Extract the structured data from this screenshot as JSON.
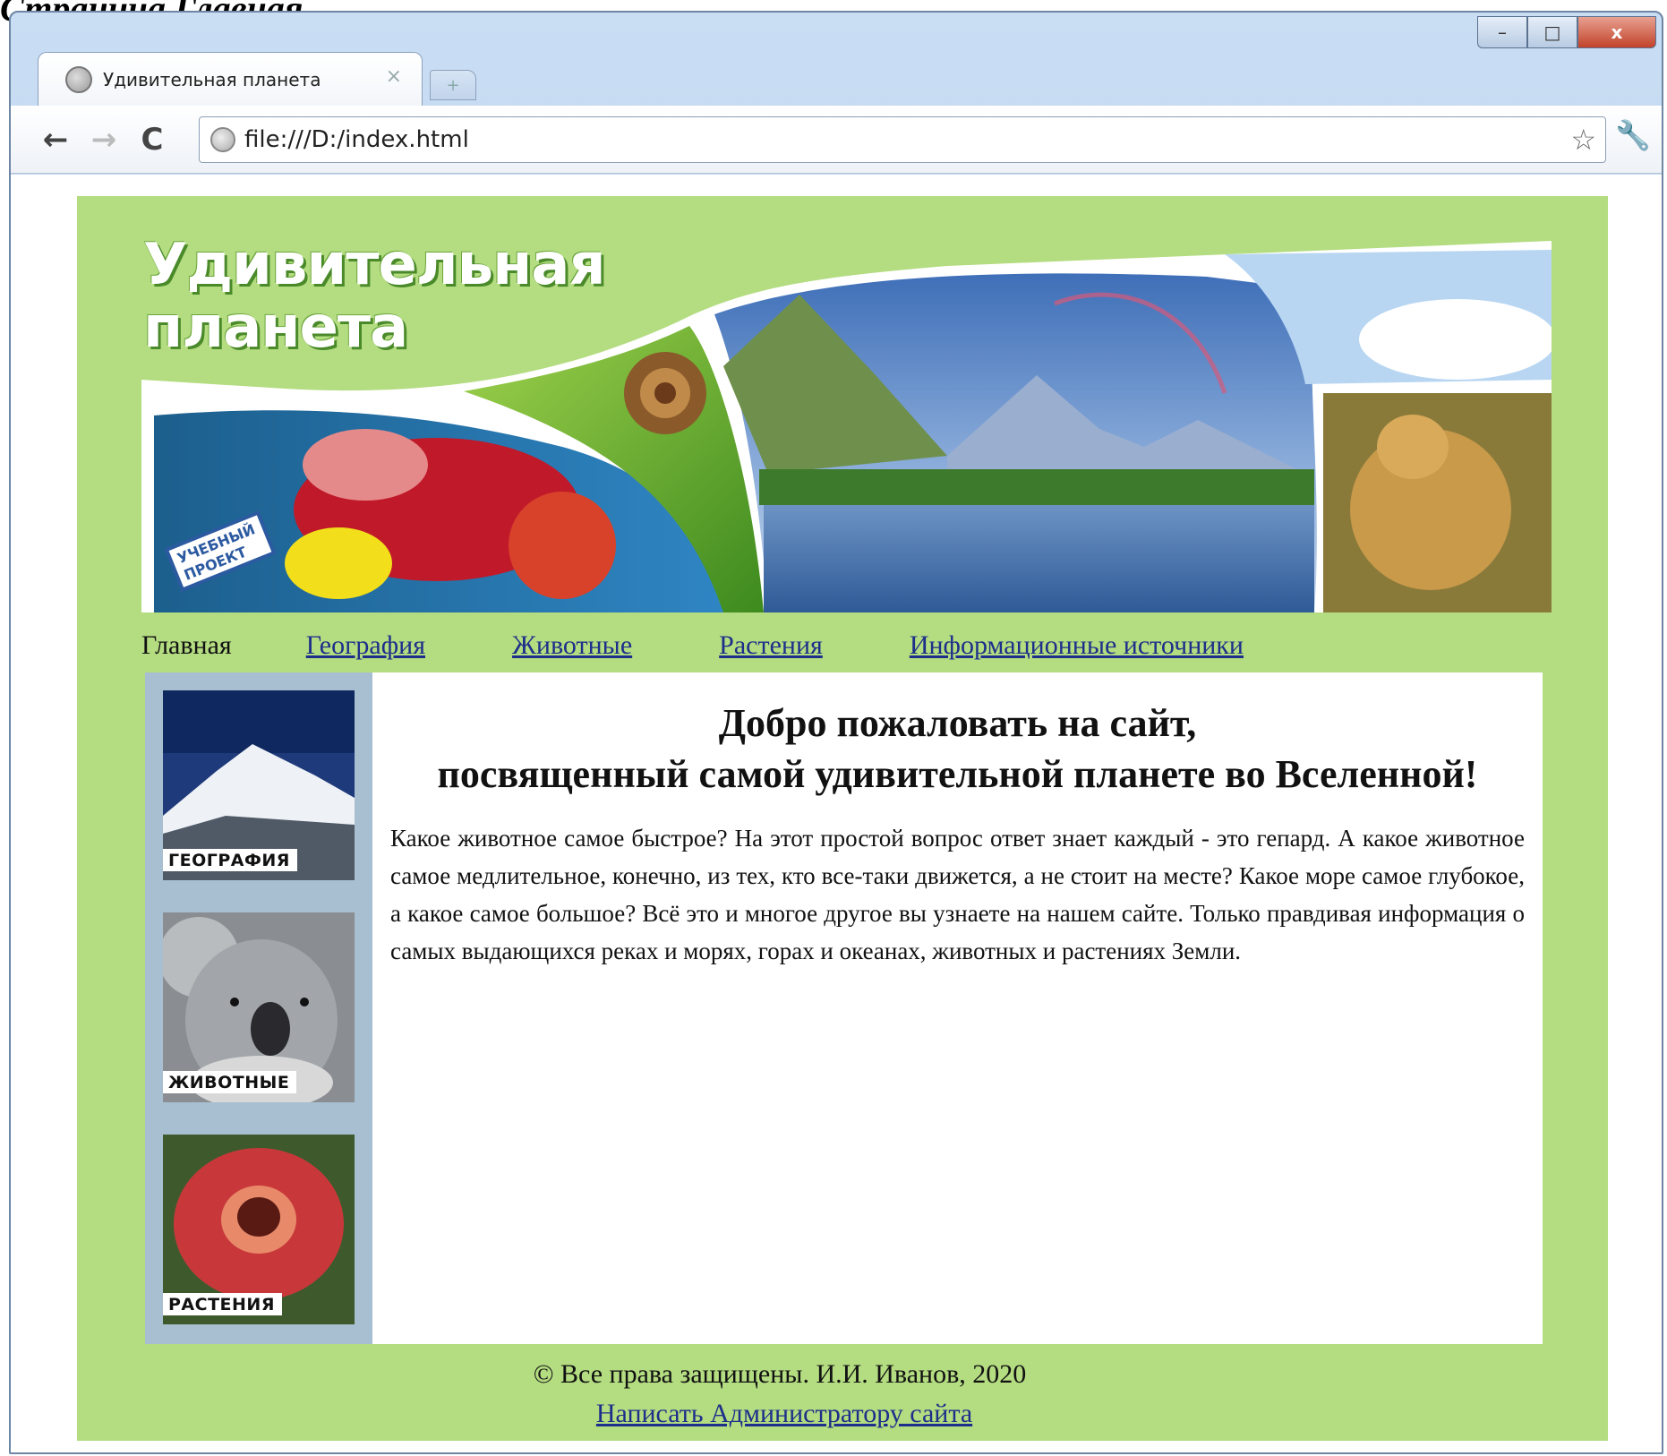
{
  "caption": "Страница Главная",
  "browser": {
    "tab_title": "Удивительная планета",
    "tab_close": "×",
    "new_tab": "+",
    "url": "file:///D:/index.html",
    "back": "←",
    "forward": "→",
    "reload": "C",
    "star": "☆",
    "wrench": "🔧",
    "window_controls": {
      "minimize": "–",
      "maximize": "□",
      "close": "x"
    }
  },
  "site": {
    "logo_line1": "Удивительная",
    "logo_line2": "планета",
    "banner_stamp": "УЧЕБНЫЙ ПРОЕКТ",
    "nav": {
      "home": "Главная",
      "geography": "География",
      "animals": "Животные",
      "plants": "Растения",
      "sources": "Информационные источники"
    },
    "sidebar": {
      "geography": "ГЕОГРАФИЯ",
      "animals": "ЖИВОТНЫЕ",
      "plants": "РАСТЕНИЯ"
    },
    "welcome_line1": "Добро пожаловать на сайт,",
    "welcome_line2": "посвященный самой удивительной планете во Вселенной!",
    "intro": "Какое животное самое быстрое? На этот простой вопрос ответ знает каждый - это гепард. А какое животное самое медлительное, конечно, из тех, кто все-таки движется, а не стоит на месте? Какое море самое глубокое, а какое самое большое? Всё это и многое другое вы узнаете на нашем сайте. Только правдивая информация о самых выдающихся реках и морях, горах и океанах, животных и растениях Земли.",
    "footer_copyright": "© Все права защищены. И.И. Иванов, 2020",
    "footer_link": "Написать Администратору сайта"
  },
  "colors": {
    "page_green": "#b4dc81",
    "sidebar_blue": "#a7bfd1",
    "link": "#1d2f8a"
  },
  "icons": [
    "globe-icon",
    "back-arrow-icon",
    "forward-arrow-icon",
    "reload-icon",
    "star-icon",
    "wrench-icon",
    "minimize-icon",
    "maximize-icon",
    "close-icon"
  ]
}
